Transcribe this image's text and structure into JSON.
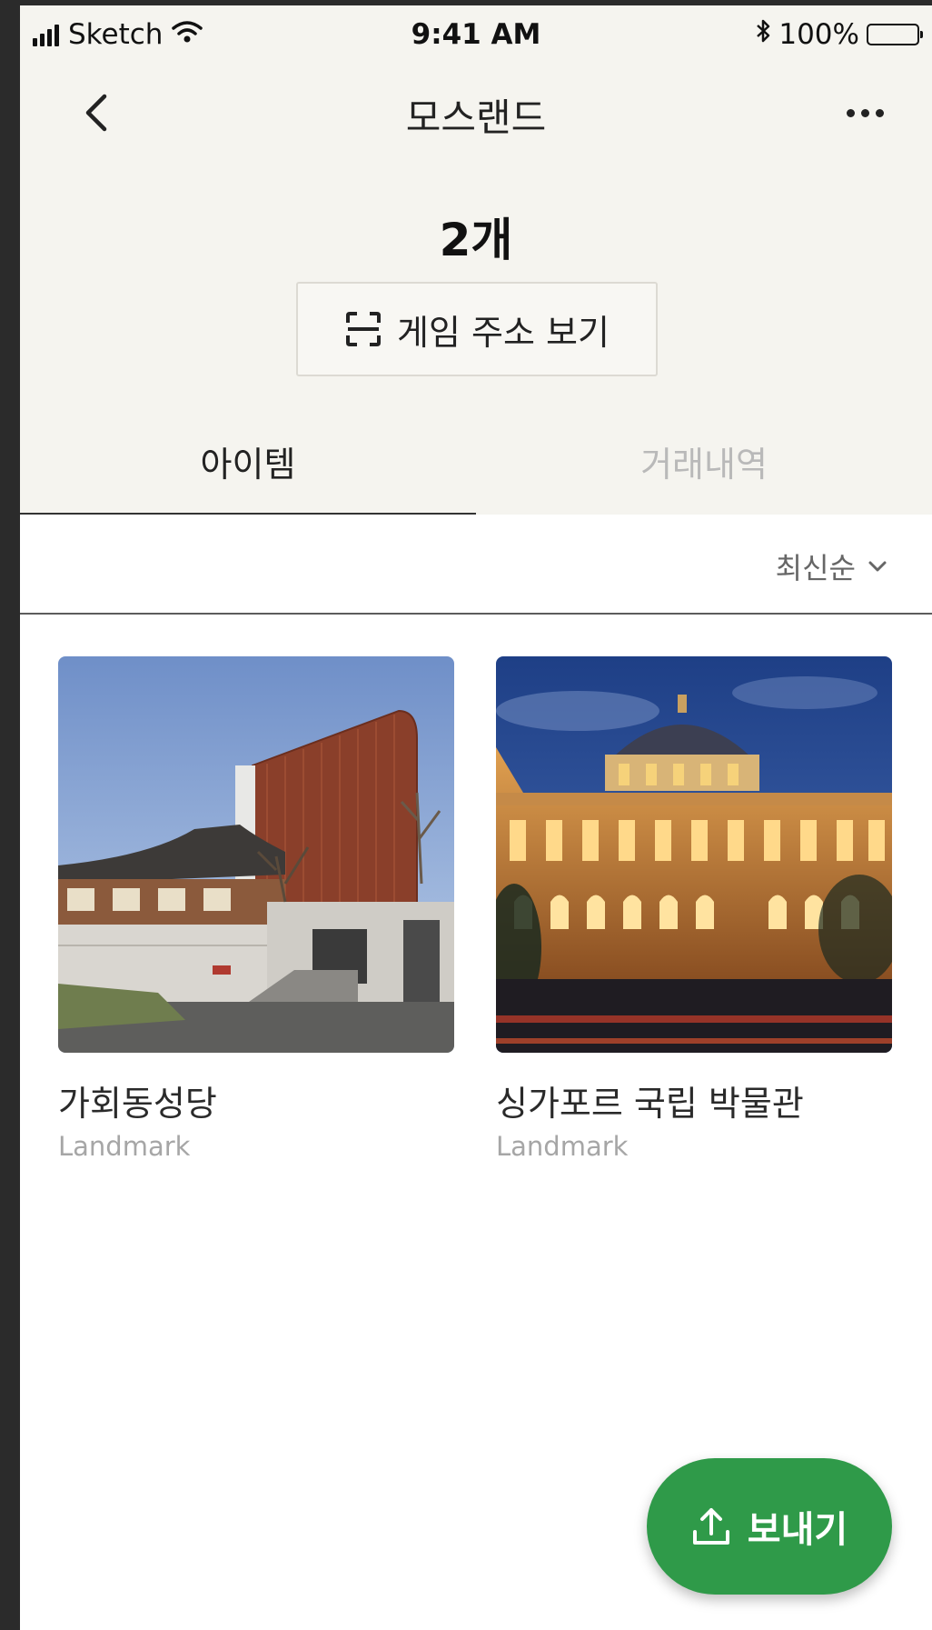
{
  "status_bar": {
    "carrier": "Sketch",
    "time": "9:41 AM",
    "battery": "100%",
    "icons": [
      "signal-icon",
      "wifi-icon",
      "bluetooth-icon",
      "battery-icon"
    ]
  },
  "nav": {
    "title": "모스랜드",
    "icons": [
      "back-icon",
      "more-icon"
    ]
  },
  "summary": {
    "count": "2개",
    "address_button": "게임 주소 보기",
    "address_icon": "scan-icon"
  },
  "tabs": [
    {
      "label": "아이템",
      "active": true
    },
    {
      "label": "거래내역",
      "active": false
    }
  ],
  "sort": {
    "label": "최신순",
    "icon": "chevron-down-icon"
  },
  "items": [
    {
      "name": "가회동성당",
      "category": "Landmark"
    },
    {
      "name": "싱가포르 국립 박물관",
      "category": "Landmark"
    }
  ],
  "send_button": {
    "label": "보내기",
    "icon": "upload-icon",
    "color": "#2f9a49"
  },
  "colors": {
    "header_bg": "#f5f4ef",
    "accent": "#2f9a49",
    "inactive_tab": "#b9b9b9"
  }
}
